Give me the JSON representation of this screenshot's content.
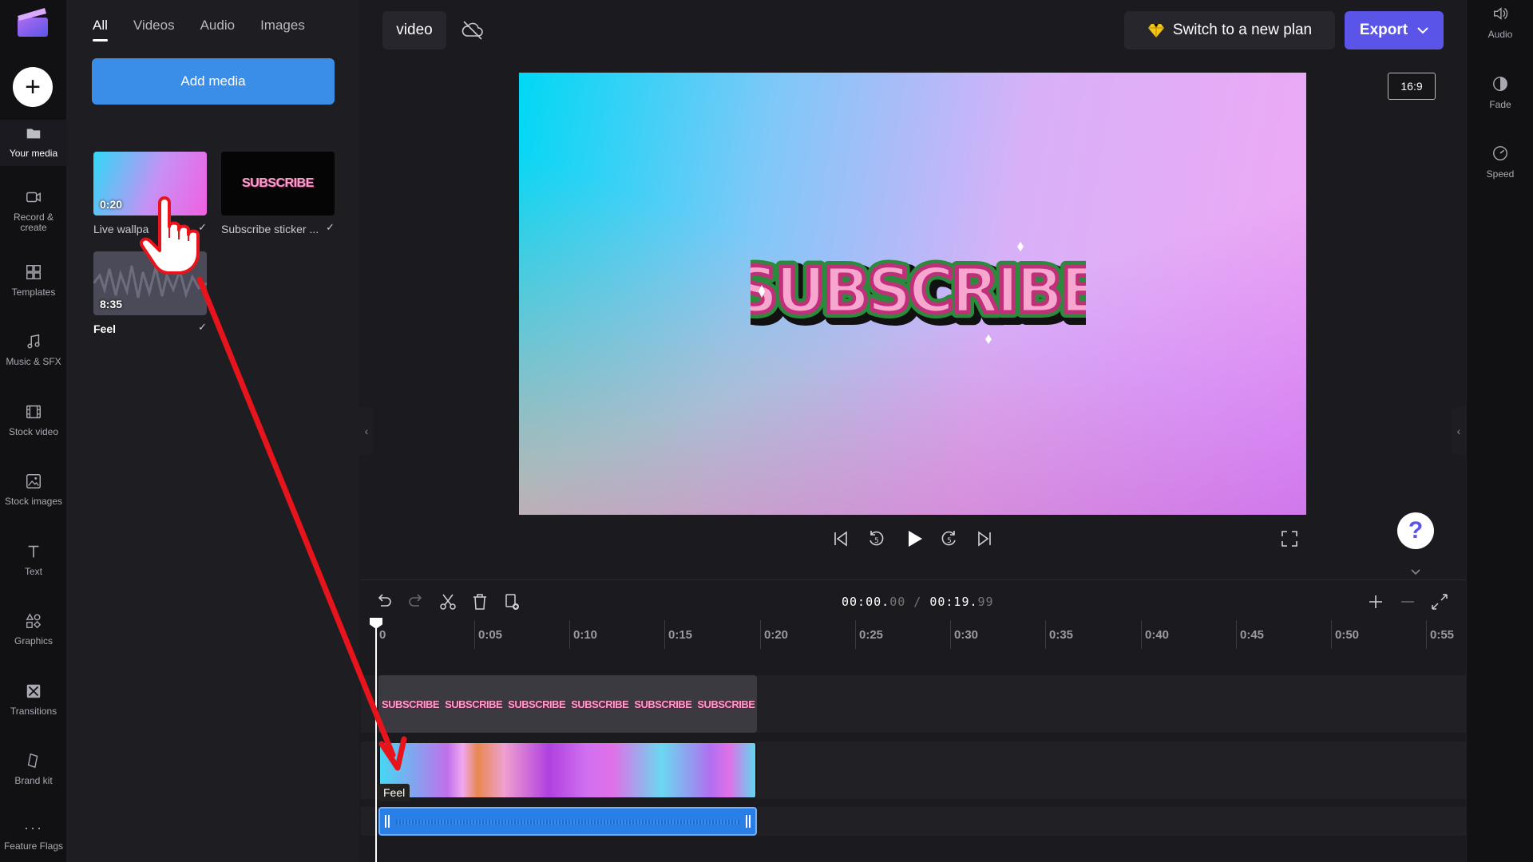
{
  "left_rail": {
    "items": [
      {
        "label": "Your media",
        "icon": "folder-icon"
      },
      {
        "label": "Record & create",
        "icon": "camera-icon"
      },
      {
        "label": "Templates",
        "icon": "templates-icon"
      },
      {
        "label": "Music & SFX",
        "icon": "music-icon"
      },
      {
        "label": "Stock video",
        "icon": "film-icon"
      },
      {
        "label": "Stock images",
        "icon": "image-icon"
      },
      {
        "label": "Text",
        "icon": "text-icon"
      },
      {
        "label": "Graphics",
        "icon": "shapes-icon"
      },
      {
        "label": "Transitions",
        "icon": "transitions-icon"
      },
      {
        "label": "Brand kit",
        "icon": "brand-icon"
      },
      {
        "label": "Feature Flags",
        "icon": "more-icon"
      }
    ]
  },
  "media_panel": {
    "tabs": [
      "All",
      "Videos",
      "Audio",
      "Images"
    ],
    "add_media_label": "Add media",
    "items": [
      {
        "name": "Live wallpa",
        "duration": "0:20",
        "check": "✓"
      },
      {
        "name": "Subscribe sticker ...",
        "duration": "",
        "check": "✓"
      },
      {
        "name": "Feel",
        "duration": "8:35",
        "check": "✓"
      }
    ],
    "sticker_text": "SUBSCRIBE"
  },
  "topbar": {
    "project_name": "video",
    "plan_label": "Switch to a new plan",
    "export_label": "Export"
  },
  "preview": {
    "aspect_ratio": "16:9",
    "sticker_text": "SUBSCRIBE",
    "help": "?"
  },
  "right_rail": {
    "items": [
      {
        "label": "Audio",
        "icon": "speaker-icon"
      },
      {
        "label": "Fade",
        "icon": "fade-icon"
      },
      {
        "label": "Speed",
        "icon": "speed-icon"
      }
    ]
  },
  "timeline": {
    "current_time": "00:00.",
    "current_frac": "00",
    "total_time": "00:19.",
    "total_frac": "99",
    "separator": "/",
    "ticks": [
      "0",
      "0:05",
      "0:10",
      "0:15",
      "0:20",
      "0:25",
      "0:30",
      "0:35",
      "0:40",
      "0:45",
      "0:50",
      "0:55"
    ],
    "sticker_clip_text": "SUBSCRIBE",
    "audio_clip_label": "Feel"
  },
  "colors": {
    "accent": "#5a55e8",
    "add_media": "#3b8ee8",
    "audio_clip": "#2a7fe6",
    "annotation_arrow": "#e8141c"
  }
}
